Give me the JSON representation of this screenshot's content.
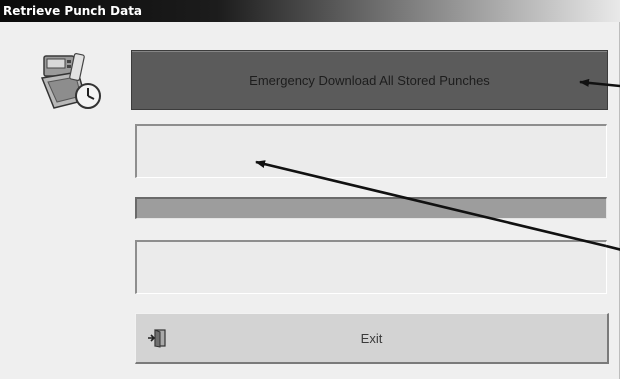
{
  "window": {
    "title": "Retrieve Punch Data",
    "icon": "time-clock-icon"
  },
  "actions": {
    "emergency_download_label": "Emergency Download All Stored Punches",
    "exit_label": "Exit",
    "exit_icon": "exit-door-icon"
  },
  "status": {
    "upper_message": "",
    "lower_message": "",
    "progress_fraction": 0
  },
  "annotations": {
    "arrow_color": "#111111",
    "count": 3
  }
}
